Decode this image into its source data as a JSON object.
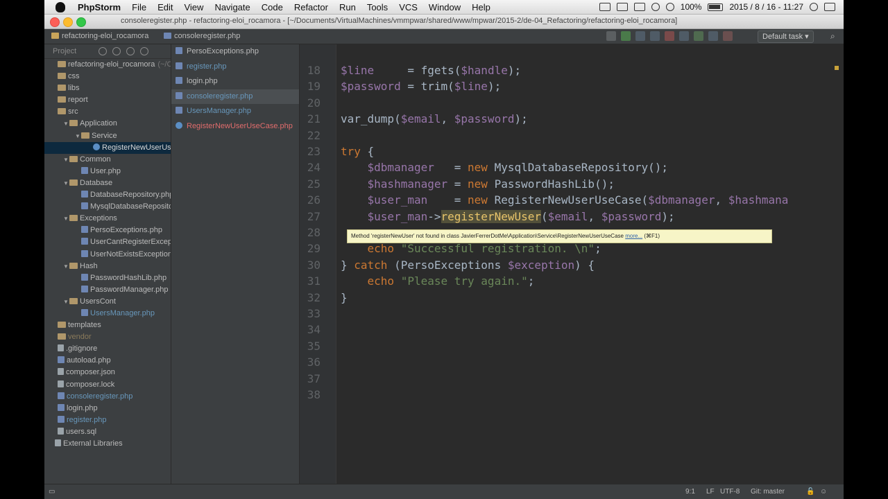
{
  "menubar": {
    "app": "PhpStorm",
    "items": [
      "File",
      "Edit",
      "View",
      "Navigate",
      "Code",
      "Refactor",
      "Run",
      "Tools",
      "VCS",
      "Window",
      "Help"
    ],
    "battery": "100%",
    "clock": "2015 / 8 / 16 - 11:27"
  },
  "window": {
    "title": "consoleregister.php - refactoring-eloi_rocamora - [~/Documents/VirtualMachines/vmmpwar/shared/www/mpwar/2015-2/de-04_Refactoring/refactoring-eloi_rocamora]"
  },
  "navbar": {
    "crumb1": "refactoring-eloi_rocamora",
    "crumb2": "consoleregister.php",
    "run_config": "Default task"
  },
  "project": {
    "tool_label": "Project",
    "tree": [
      {
        "label": "refactoring-eloi_rocamora",
        "suffix": "(~/C",
        "depth": 0,
        "type": "root"
      },
      {
        "label": "css",
        "depth": 0,
        "type": "folder"
      },
      {
        "label": "libs",
        "depth": 0,
        "type": "folder"
      },
      {
        "label": "report",
        "depth": 0,
        "type": "folder"
      },
      {
        "label": "src",
        "depth": 0,
        "type": "folder"
      },
      {
        "label": "Application",
        "depth": 1,
        "type": "folder",
        "open": true
      },
      {
        "label": "Service",
        "depth": 2,
        "type": "folder",
        "open": true
      },
      {
        "label": "RegisterNewUserUseCase.php",
        "depth": 3,
        "type": "class",
        "selected": true
      },
      {
        "label": "Common",
        "depth": 1,
        "type": "folder",
        "open": true
      },
      {
        "label": "User.php",
        "depth": 2,
        "type": "php"
      },
      {
        "label": "Database",
        "depth": 1,
        "type": "folder",
        "open": true
      },
      {
        "label": "DatabaseRepository.php",
        "depth": 2,
        "type": "php"
      },
      {
        "label": "MysqlDatabaseRepository.php",
        "depth": 2,
        "type": "php"
      },
      {
        "label": "Exceptions",
        "depth": 1,
        "type": "folder",
        "open": true
      },
      {
        "label": "PersoExceptions.php",
        "depth": 2,
        "type": "php"
      },
      {
        "label": "UserCantRegisterException.php",
        "depth": 2,
        "type": "php"
      },
      {
        "label": "UserNotExistsException.php",
        "depth": 2,
        "type": "php"
      },
      {
        "label": "Hash",
        "depth": 1,
        "type": "folder",
        "open": true
      },
      {
        "label": "PasswordHashLib.php",
        "depth": 2,
        "type": "php"
      },
      {
        "label": "PasswordManager.php",
        "depth": 2,
        "type": "php"
      },
      {
        "label": "UsersCont",
        "depth": 1,
        "type": "folder",
        "open": true
      },
      {
        "label": "UsersManager.php",
        "depth": 2,
        "type": "php",
        "color": "blue"
      },
      {
        "label": "templates",
        "depth": 0,
        "type": "folder"
      },
      {
        "label": "vendor",
        "depth": 0,
        "type": "folder",
        "color": "dim"
      },
      {
        "label": ".gitignore",
        "depth": 0,
        "type": "doc"
      },
      {
        "label": "autoload.php",
        "depth": 0,
        "type": "php"
      },
      {
        "label": "composer.json",
        "depth": 0,
        "type": "doc"
      },
      {
        "label": "composer.lock",
        "depth": 0,
        "type": "doc"
      },
      {
        "label": "consoleregister.php",
        "depth": 0,
        "type": "php",
        "color": "blue"
      },
      {
        "label": "login.php",
        "depth": 0,
        "type": "php"
      },
      {
        "label": "register.php",
        "depth": 0,
        "type": "php",
        "color": "blue"
      },
      {
        "label": "users.sql",
        "depth": 0,
        "type": "doc"
      },
      {
        "label": "External Libraries",
        "depth": -1,
        "type": "libs"
      }
    ]
  },
  "files": [
    {
      "label": "PersoExceptions.php",
      "color": "normal"
    },
    {
      "label": "register.php",
      "color": "blue"
    },
    {
      "label": "login.php",
      "color": "normal"
    },
    {
      "label": "consoleregister.php",
      "color": "blue",
      "selected": true
    },
    {
      "label": "UsersManager.php",
      "color": "blue"
    },
    {
      "label": "RegisterNewUserUseCase.php",
      "color": "red"
    }
  ],
  "editor": {
    "lines": [
      {
        "n": "18",
        "tokens": [
          [
            "var",
            "$line"
          ],
          [
            "p",
            "     = fgets("
          ],
          [
            "var",
            "$handle"
          ],
          [
            "p",
            ");"
          ]
        ]
      },
      {
        "n": "19",
        "tokens": [
          [
            "var",
            "$password"
          ],
          [
            "p",
            " = trim("
          ],
          [
            "var",
            "$line"
          ],
          [
            "p",
            ");"
          ]
        ]
      },
      {
        "n": "20",
        "tokens": []
      },
      {
        "n": "21",
        "tokens": [
          [
            "p",
            "var_dump("
          ],
          [
            "var",
            "$email"
          ],
          [
            "p",
            ", "
          ],
          [
            "var",
            "$password"
          ],
          [
            "p",
            ");"
          ]
        ]
      },
      {
        "n": "22",
        "tokens": []
      },
      {
        "n": "23",
        "tokens": [
          [
            "kw",
            "try"
          ],
          [
            "p",
            " {"
          ]
        ]
      },
      {
        "n": "24",
        "tokens": [
          [
            "p",
            "    "
          ],
          [
            "var",
            "$dbmanager"
          ],
          [
            "p",
            "   = "
          ],
          [
            "kw",
            "new"
          ],
          [
            "p",
            " MysqlDatabaseRepository();"
          ]
        ]
      },
      {
        "n": "25",
        "tokens": [
          [
            "p",
            "    "
          ],
          [
            "var",
            "$hashmanager"
          ],
          [
            "p",
            " = "
          ],
          [
            "kw",
            "new"
          ],
          [
            "p",
            " PasswordHashLib();"
          ]
        ]
      },
      {
        "n": "26",
        "tokens": [
          [
            "p",
            "    "
          ],
          [
            "var",
            "$user_man"
          ],
          [
            "p",
            "    = "
          ],
          [
            "kw",
            "new"
          ],
          [
            "p",
            " RegisterNewUserUseCase("
          ],
          [
            "var",
            "$dbmanager"
          ],
          [
            "p",
            ", "
          ],
          [
            "var",
            "$hashmana"
          ]
        ]
      },
      {
        "n": "27",
        "tokens": [
          [
            "p",
            "    "
          ],
          [
            "var",
            "$user_man"
          ],
          [
            "p",
            "->"
          ],
          [
            "hl",
            "registerNewUser"
          ],
          [
            "p",
            "("
          ],
          [
            "var",
            "$email"
          ],
          [
            "p",
            ", "
          ],
          [
            "var",
            "$password"
          ],
          [
            "p",
            ");"
          ]
        ]
      },
      {
        "n": "28",
        "tokens": []
      },
      {
        "n": "29",
        "tokens": [
          [
            "p",
            "    "
          ],
          [
            "kw",
            "echo"
          ],
          [
            "p",
            " "
          ],
          [
            "str",
            "\"Successful registration. \\n\""
          ],
          [
            "p",
            ";"
          ]
        ]
      },
      {
        "n": "30",
        "tokens": [
          [
            "p",
            "} "
          ],
          [
            "kw",
            "catch"
          ],
          [
            "p",
            " (PersoExceptions "
          ],
          [
            "var",
            "$exception"
          ],
          [
            "p",
            ") {"
          ]
        ]
      },
      {
        "n": "31",
        "tokens": [
          [
            "p",
            "    "
          ],
          [
            "kw",
            "echo"
          ],
          [
            "p",
            " "
          ],
          [
            "str",
            "\"Please try again.\""
          ],
          [
            "p",
            ";"
          ]
        ]
      },
      {
        "n": "32",
        "tokens": [
          [
            "p",
            "}"
          ]
        ]
      },
      {
        "n": "33",
        "tokens": []
      },
      {
        "n": "34",
        "tokens": []
      },
      {
        "n": "35",
        "tokens": []
      },
      {
        "n": "36",
        "tokens": []
      },
      {
        "n": "37",
        "tokens": []
      },
      {
        "n": "38",
        "tokens": []
      }
    ],
    "tooltip": {
      "text": "Method 'registerNewUser' not found in class JavierFerrerDotMe\\Application\\Service\\RegisterNewUserUseCase",
      "more": "more...",
      "shortcut": "(⌘F1)"
    }
  },
  "status": {
    "position": "9:1",
    "line_sep": "LF",
    "encoding": "UTF-8",
    "vcs": "Git: master"
  },
  "colors": {
    "background": "#2b2b2b",
    "keyword": "#cc7832",
    "variable": "#9876aa",
    "string": "#6a8759",
    "text": "#a9b7c6",
    "highlight": "#e8c46a"
  }
}
